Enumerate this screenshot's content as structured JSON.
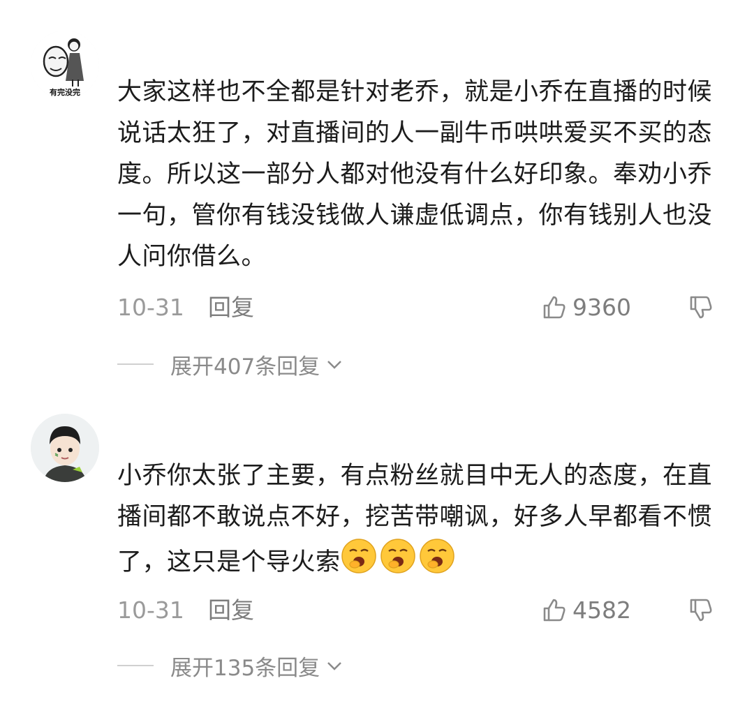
{
  "comments": [
    {
      "avatar_caption": "有完没完",
      "text": "大家这样也不全都是针对老乔，就是小乔在直播的时候说话太狂了，对直播间的人一副牛币哄哄爱买不买的态度。所以这一部分人都对他没有什么好印象。奉劝小乔一句，管你有钱没钱做人谦虚低调点，你有钱别人也没人问你借么。",
      "date": "10-31",
      "reply_label": "回复",
      "likes": "9360",
      "expand_label": "展开407条回复"
    },
    {
      "text": "小乔你太张了主要，有点粉丝就目中无人的态度，在直播间都不敢说点不好，挖苦带嘲讽，好多人早都看不惯了，这只是个导火索",
      "emojis": [
        "yawn-emoji",
        "yawn-emoji",
        "yawn-emoji"
      ],
      "date": "10-31",
      "reply_label": "回复",
      "likes": "4582",
      "expand_label": "展开135条回复"
    }
  ],
  "icons": {
    "like": "thumbs-up-icon",
    "dislike": "thumbs-down-icon",
    "expand": "chevron-down-icon"
  },
  "colors": {
    "text": "#1c1c1c",
    "meta": "#9a9a9a",
    "divider": "#d0d0d0"
  }
}
